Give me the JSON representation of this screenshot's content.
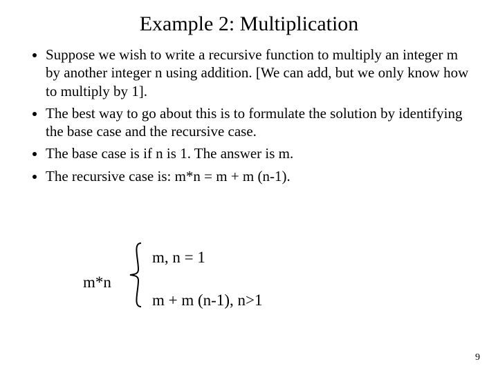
{
  "title": "Example 2:  Multiplication",
  "bullets": {
    "b1": "Suppose we wish to write a recursive function to multiply an integer m by another integer n using addition.  [We can add, but we only know how to multiply by 1].",
    "b2": "The best way to go about this is to formulate the solution by identifying the base case and the recursive case.",
    "b3": "The base case is if n is 1.  The answer is m.",
    "b4": "The recursive case is: m*n = m + m (n-1)."
  },
  "formula": {
    "lhs": "m*n",
    "case1": "m,   n = 1",
    "case2": "m + m (n-1),   n>1"
  },
  "page": "9"
}
